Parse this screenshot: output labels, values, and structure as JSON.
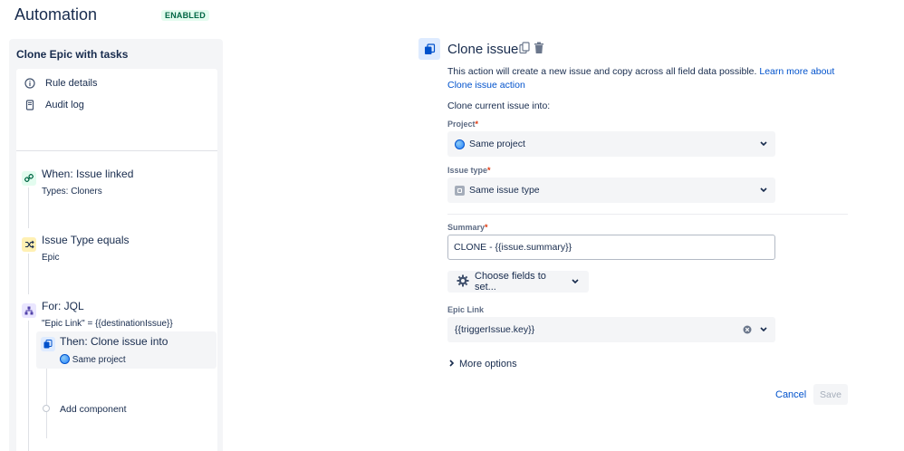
{
  "header": {
    "title": "Automation",
    "status_badge": "ENABLED"
  },
  "sidebar": {
    "rule_name": "Clone Epic with tasks",
    "nav": [
      {
        "label": "Rule details",
        "icon": "info-icon"
      },
      {
        "label": "Audit log",
        "icon": "document-icon"
      }
    ],
    "components": [
      {
        "title": "When: Issue linked",
        "subtitle": "Types: Cloners",
        "icon": "link-icon",
        "color": "#e3fcef"
      },
      {
        "title": "Issue Type equals",
        "subtitle": "Epic",
        "icon": "shuffle-icon",
        "color": "#fff0b3"
      },
      {
        "title": "For: JQL",
        "subtitle": "\"Epic Link\" = {{destinationIssue}}",
        "icon": "branch-icon",
        "color": "#eae6ff"
      },
      {
        "title": "Then: Clone issue into",
        "subtitle": "Same project",
        "icon": "copy-icon",
        "color": "#deebff"
      }
    ],
    "add_component": "Add component"
  },
  "form": {
    "title": "Clone issue",
    "description": "This action will create a new issue and copy across all field data possible.",
    "learn_more": "Learn more about Clone issue action",
    "clone_into_label": "Clone current issue into:",
    "project_label": "Project",
    "project_value": "Same project",
    "issue_type_label": "Issue type",
    "issue_type_value": "Same issue type",
    "summary_label": "Summary",
    "summary_value": "CLONE - {{issue.summary}}",
    "choose_fields": "Choose fields to set...",
    "epic_link_label": "Epic Link",
    "epic_link_value": "{{triggerIssue.key}}",
    "more_options": "More options",
    "cancel": "Cancel",
    "save": "Save",
    "required_mark": "*"
  },
  "colors": {
    "accent": "#0052cc",
    "required": "#de350b",
    "enabled": "#006644"
  }
}
